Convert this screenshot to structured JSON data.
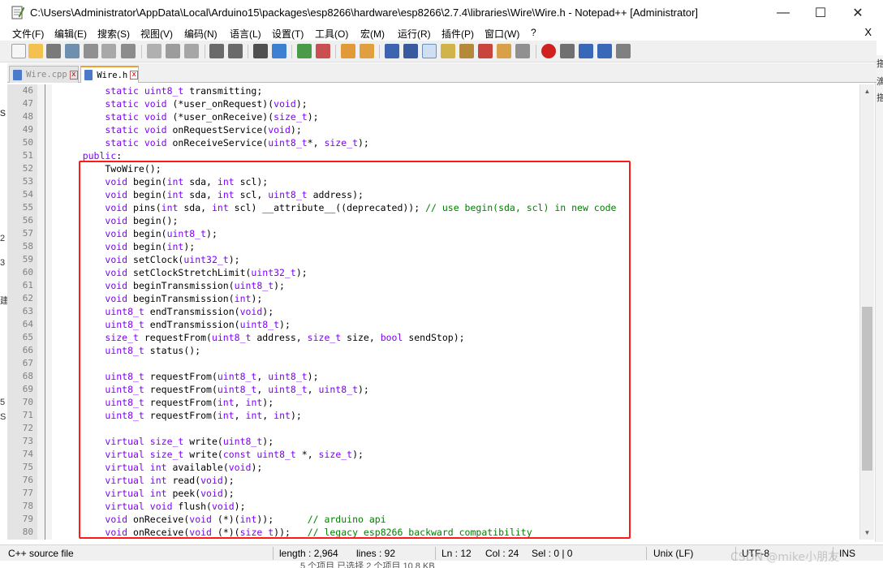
{
  "window": {
    "title": "C:\\Users\\Administrator\\AppData\\Local\\Arduino15\\packages\\esp8266\\hardware\\esp8266\\2.7.4\\libraries\\Wire\\Wire.h - Notepad++ [Administrator]",
    "minimize": "—",
    "maximize": "☐",
    "close": "✕"
  },
  "menu": {
    "items": [
      "文件(F)",
      "编辑(E)",
      "搜索(S)",
      "视图(V)",
      "编码(N)",
      "语言(L)",
      "设置(T)",
      "工具(O)",
      "宏(M)",
      "运行(R)",
      "插件(P)",
      "窗口(W)",
      "?"
    ],
    "close_doc": "X"
  },
  "tabs": [
    {
      "label": "Wire.cpp",
      "close": "x",
      "active": false
    },
    {
      "label": "Wire.h",
      "close": "x",
      "active": true
    }
  ],
  "editor": {
    "lines": [
      {
        "n": "46",
        "tokens": [
          [
            "tx",
            "        "
          ],
          [
            "kw",
            "static"
          ],
          [
            "tx",
            " "
          ],
          [
            "ty",
            "uint8_t"
          ],
          [
            "tx",
            " transmitting;"
          ]
        ]
      },
      {
        "n": "47",
        "tokens": [
          [
            "tx",
            "        "
          ],
          [
            "kw",
            "static"
          ],
          [
            "tx",
            " "
          ],
          [
            "kw",
            "void"
          ],
          [
            "tx",
            " (*user_onRequest)("
          ],
          [
            "kw",
            "void"
          ],
          [
            "tx",
            ");"
          ]
        ]
      },
      {
        "n": "48",
        "tokens": [
          [
            "tx",
            "        "
          ],
          [
            "kw",
            "static"
          ],
          [
            "tx",
            " "
          ],
          [
            "kw",
            "void"
          ],
          [
            "tx",
            " (*user_onReceive)("
          ],
          [
            "ty",
            "size_t"
          ],
          [
            "tx",
            ");"
          ]
        ]
      },
      {
        "n": "49",
        "tokens": [
          [
            "tx",
            "        "
          ],
          [
            "kw",
            "static"
          ],
          [
            "tx",
            " "
          ],
          [
            "kw",
            "void"
          ],
          [
            "tx",
            " onRequestService("
          ],
          [
            "kw",
            "void"
          ],
          [
            "tx",
            ");"
          ]
        ]
      },
      {
        "n": "50",
        "tokens": [
          [
            "tx",
            "        "
          ],
          [
            "kw",
            "static"
          ],
          [
            "tx",
            " "
          ],
          [
            "kw",
            "void"
          ],
          [
            "tx",
            " onReceiveService("
          ],
          [
            "ty",
            "uint8_t"
          ],
          [
            "tx",
            "*, "
          ],
          [
            "ty",
            "size_t"
          ],
          [
            "tx",
            ");"
          ]
        ]
      },
      {
        "n": "51",
        "tokens": [
          [
            "tx",
            "    "
          ],
          [
            "kw",
            "public"
          ],
          [
            "tx",
            ":"
          ]
        ]
      },
      {
        "n": "52",
        "tokens": [
          [
            "tx",
            "        TwoWire();"
          ]
        ]
      },
      {
        "n": "53",
        "tokens": [
          [
            "tx",
            "        "
          ],
          [
            "kw",
            "void"
          ],
          [
            "tx",
            " begin("
          ],
          [
            "kw",
            "int"
          ],
          [
            "tx",
            " sda, "
          ],
          [
            "kw",
            "int"
          ],
          [
            "tx",
            " scl);"
          ]
        ]
      },
      {
        "n": "54",
        "tokens": [
          [
            "tx",
            "        "
          ],
          [
            "kw",
            "void"
          ],
          [
            "tx",
            " begin("
          ],
          [
            "kw",
            "int"
          ],
          [
            "tx",
            " sda, "
          ],
          [
            "kw",
            "int"
          ],
          [
            "tx",
            " scl, "
          ],
          [
            "ty",
            "uint8_t"
          ],
          [
            "tx",
            " address);"
          ]
        ]
      },
      {
        "n": "55",
        "tokens": [
          [
            "tx",
            "        "
          ],
          [
            "kw",
            "void"
          ],
          [
            "tx",
            " pins("
          ],
          [
            "kw",
            "int"
          ],
          [
            "tx",
            " sda, "
          ],
          [
            "kw",
            "int"
          ],
          [
            "tx",
            " scl) __attribute__((deprecated)); "
          ],
          [
            "cm",
            "// use begin(sda, scl) in new code"
          ]
        ]
      },
      {
        "n": "56",
        "tokens": [
          [
            "tx",
            "        "
          ],
          [
            "kw",
            "void"
          ],
          [
            "tx",
            " begin();"
          ]
        ]
      },
      {
        "n": "57",
        "tokens": [
          [
            "tx",
            "        "
          ],
          [
            "kw",
            "void"
          ],
          [
            "tx",
            " begin("
          ],
          [
            "ty",
            "uint8_t"
          ],
          [
            "tx",
            ");"
          ]
        ]
      },
      {
        "n": "58",
        "tokens": [
          [
            "tx",
            "        "
          ],
          [
            "kw",
            "void"
          ],
          [
            "tx",
            " begin("
          ],
          [
            "kw",
            "int"
          ],
          [
            "tx",
            ");"
          ]
        ]
      },
      {
        "n": "59",
        "tokens": [
          [
            "tx",
            "        "
          ],
          [
            "kw",
            "void"
          ],
          [
            "tx",
            " setClock("
          ],
          [
            "ty",
            "uint32_t"
          ],
          [
            "tx",
            ");"
          ]
        ]
      },
      {
        "n": "60",
        "tokens": [
          [
            "tx",
            "        "
          ],
          [
            "kw",
            "void"
          ],
          [
            "tx",
            " setClockStretchLimit("
          ],
          [
            "ty",
            "uint32_t"
          ],
          [
            "tx",
            ");"
          ]
        ]
      },
      {
        "n": "61",
        "tokens": [
          [
            "tx",
            "        "
          ],
          [
            "kw",
            "void"
          ],
          [
            "tx",
            " beginTransmission("
          ],
          [
            "ty",
            "uint8_t"
          ],
          [
            "tx",
            ");"
          ]
        ]
      },
      {
        "n": "62",
        "tokens": [
          [
            "tx",
            "        "
          ],
          [
            "kw",
            "void"
          ],
          [
            "tx",
            " beginTransmission("
          ],
          [
            "kw",
            "int"
          ],
          [
            "tx",
            ");"
          ]
        ]
      },
      {
        "n": "63",
        "tokens": [
          [
            "tx",
            "        "
          ],
          [
            "ty",
            "uint8_t"
          ],
          [
            "tx",
            " endTransmission("
          ],
          [
            "kw",
            "void"
          ],
          [
            "tx",
            ");"
          ]
        ]
      },
      {
        "n": "64",
        "tokens": [
          [
            "tx",
            "        "
          ],
          [
            "ty",
            "uint8_t"
          ],
          [
            "tx",
            " endTransmission("
          ],
          [
            "ty",
            "uint8_t"
          ],
          [
            "tx",
            ");"
          ]
        ]
      },
      {
        "n": "65",
        "tokens": [
          [
            "tx",
            "        "
          ],
          [
            "ty",
            "size_t"
          ],
          [
            "tx",
            " requestFrom("
          ],
          [
            "ty",
            "uint8_t"
          ],
          [
            "tx",
            " address, "
          ],
          [
            "ty",
            "size_t"
          ],
          [
            "tx",
            " size, "
          ],
          [
            "kw",
            "bool"
          ],
          [
            "tx",
            " sendStop);"
          ]
        ]
      },
      {
        "n": "66",
        "tokens": [
          [
            "tx",
            "        "
          ],
          [
            "ty",
            "uint8_t"
          ],
          [
            "tx",
            " status();"
          ]
        ]
      },
      {
        "n": "67",
        "tokens": []
      },
      {
        "n": "68",
        "tokens": [
          [
            "tx",
            "        "
          ],
          [
            "ty",
            "uint8_t"
          ],
          [
            "tx",
            " requestFrom("
          ],
          [
            "ty",
            "uint8_t"
          ],
          [
            "tx",
            ", "
          ],
          [
            "ty",
            "uint8_t"
          ],
          [
            "tx",
            ");"
          ]
        ]
      },
      {
        "n": "69",
        "tokens": [
          [
            "tx",
            "        "
          ],
          [
            "ty",
            "uint8_t"
          ],
          [
            "tx",
            " requestFrom("
          ],
          [
            "ty",
            "uint8_t"
          ],
          [
            "tx",
            ", "
          ],
          [
            "ty",
            "uint8_t"
          ],
          [
            "tx",
            ", "
          ],
          [
            "ty",
            "uint8_t"
          ],
          [
            "tx",
            ");"
          ]
        ]
      },
      {
        "n": "70",
        "tokens": [
          [
            "tx",
            "        "
          ],
          [
            "ty",
            "uint8_t"
          ],
          [
            "tx",
            " requestFrom("
          ],
          [
            "kw",
            "int"
          ],
          [
            "tx",
            ", "
          ],
          [
            "kw",
            "int"
          ],
          [
            "tx",
            ");"
          ]
        ]
      },
      {
        "n": "71",
        "tokens": [
          [
            "tx",
            "        "
          ],
          [
            "ty",
            "uint8_t"
          ],
          [
            "tx",
            " requestFrom("
          ],
          [
            "kw",
            "int"
          ],
          [
            "tx",
            ", "
          ],
          [
            "kw",
            "int"
          ],
          [
            "tx",
            ", "
          ],
          [
            "kw",
            "int"
          ],
          [
            "tx",
            ");"
          ]
        ]
      },
      {
        "n": "72",
        "tokens": []
      },
      {
        "n": "73",
        "tokens": [
          [
            "tx",
            "        "
          ],
          [
            "kw",
            "virtual"
          ],
          [
            "tx",
            " "
          ],
          [
            "ty",
            "size_t"
          ],
          [
            "tx",
            " write("
          ],
          [
            "ty",
            "uint8_t"
          ],
          [
            "tx",
            ");"
          ]
        ]
      },
      {
        "n": "74",
        "tokens": [
          [
            "tx",
            "        "
          ],
          [
            "kw",
            "virtual"
          ],
          [
            "tx",
            " "
          ],
          [
            "ty",
            "size_t"
          ],
          [
            "tx",
            " write("
          ],
          [
            "kw",
            "const"
          ],
          [
            "tx",
            " "
          ],
          [
            "ty",
            "uint8_t"
          ],
          [
            "tx",
            " *, "
          ],
          [
            "ty",
            "size_t"
          ],
          [
            "tx",
            ");"
          ]
        ]
      },
      {
        "n": "75",
        "tokens": [
          [
            "tx",
            "        "
          ],
          [
            "kw",
            "virtual"
          ],
          [
            "tx",
            " "
          ],
          [
            "kw",
            "int"
          ],
          [
            "tx",
            " available("
          ],
          [
            "kw",
            "void"
          ],
          [
            "tx",
            ");"
          ]
        ]
      },
      {
        "n": "76",
        "tokens": [
          [
            "tx",
            "        "
          ],
          [
            "kw",
            "virtual"
          ],
          [
            "tx",
            " "
          ],
          [
            "kw",
            "int"
          ],
          [
            "tx",
            " read("
          ],
          [
            "kw",
            "void"
          ],
          [
            "tx",
            ");"
          ]
        ]
      },
      {
        "n": "77",
        "tokens": [
          [
            "tx",
            "        "
          ],
          [
            "kw",
            "virtual"
          ],
          [
            "tx",
            " "
          ],
          [
            "kw",
            "int"
          ],
          [
            "tx",
            " peek("
          ],
          [
            "kw",
            "void"
          ],
          [
            "tx",
            ");"
          ]
        ]
      },
      {
        "n": "78",
        "tokens": [
          [
            "tx",
            "        "
          ],
          [
            "kw",
            "virtual"
          ],
          [
            "tx",
            " "
          ],
          [
            "kw",
            "void"
          ],
          [
            "tx",
            " flush("
          ],
          [
            "kw",
            "void"
          ],
          [
            "tx",
            ");"
          ]
        ]
      },
      {
        "n": "79",
        "tokens": [
          [
            "tx",
            "        "
          ],
          [
            "kw",
            "void"
          ],
          [
            "tx",
            " onReceive("
          ],
          [
            "kw",
            "void"
          ],
          [
            "tx",
            " (*)("
          ],
          [
            "kw",
            "int"
          ],
          [
            "tx",
            "));      "
          ],
          [
            "cm",
            "// arduino api"
          ]
        ]
      },
      {
        "n": "80",
        "tokens": [
          [
            "tx",
            "        "
          ],
          [
            "kw",
            "void"
          ],
          [
            "tx",
            " onReceive("
          ],
          [
            "kw",
            "void"
          ],
          [
            "tx",
            " (*)("
          ],
          [
            "ty",
            "size_t"
          ],
          [
            "tx",
            "));   "
          ],
          [
            "cm",
            "// legacy esp8266 backward compatibility"
          ]
        ]
      }
    ]
  },
  "status": {
    "filetype": "C++ source file",
    "length": "length : 2,964",
    "lines": "lines : 92",
    "ln": "Ln : 12",
    "col": "Col : 24",
    "sel": "Sel : 0 | 0",
    "eol": "Unix (LF)",
    "encoding": "UTF-8",
    "mode": "INS"
  },
  "background": {
    "left_chars": [
      "s",
      "2",
      "3",
      "建",
      "5",
      "S"
    ],
    "right_chars": [
      "搭",
      "滴",
      "搭"
    ],
    "bottom_text": "5 个项目    已选择 2 个项目  10.8 KB"
  },
  "watermark": "CSDN @mike小朋友",
  "colors": {
    "keyword": "#8000ff",
    "comment": "#008000",
    "highlight_box": "#ff1a1a",
    "gutter": "#e4e4e4"
  }
}
